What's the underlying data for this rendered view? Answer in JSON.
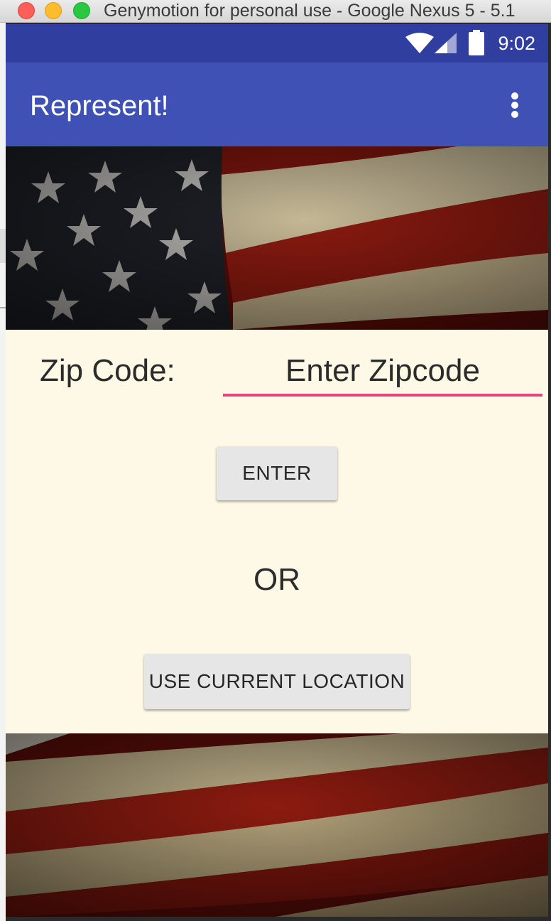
{
  "window": {
    "title": "Genymotion for personal use - Google Nexus 5 - 5.1"
  },
  "status_bar": {
    "time": "9:02",
    "icons": [
      "wifi-icon",
      "cell-signal-icon",
      "battery-icon"
    ]
  },
  "app_bar": {
    "title": "Represent!",
    "menu_icon": "more-vert-icon"
  },
  "form": {
    "zip_label": "Zip Code:",
    "zip_placeholder": "Enter Zipcode",
    "zip_value": "",
    "enter_button": "ENTER",
    "or_text": "OR",
    "location_button": "USE CURRENT LOCATION"
  },
  "colors": {
    "status_bar": "#303f9f",
    "app_bar": "#3f51b5",
    "input_underline": "#e8437a",
    "panel_background": "#fef8e6",
    "button_background": "#e6e6e6"
  }
}
